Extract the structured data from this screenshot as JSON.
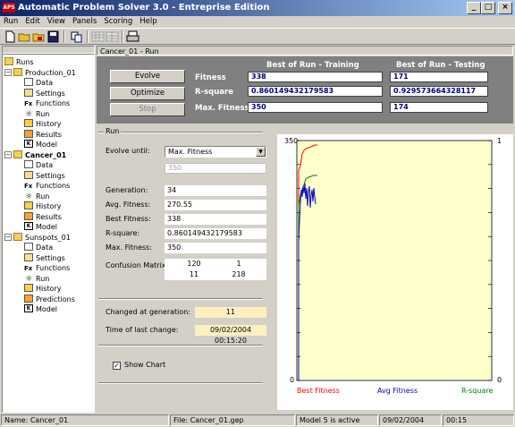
{
  "window": {
    "title": "Automatic Problem Solver 3.0 - Entreprise Edition",
    "logo_text": "APS"
  },
  "menu": [
    "Run",
    "Edit",
    "View",
    "Panels",
    "Scoring",
    "Help"
  ],
  "tree": {
    "root": "Runs",
    "projects": [
      {
        "name": "Production_01",
        "items": [
          "Data",
          "Settings",
          "Functions",
          "Run",
          "History",
          "Results",
          "Model"
        ]
      },
      {
        "name": "Cancer_01",
        "items": [
          "Data",
          "Settings",
          "Functions",
          "Run",
          "History",
          "Results",
          "Model"
        ]
      },
      {
        "name": "Sunspots_01",
        "items": [
          "Data",
          "Settings",
          "Functions",
          "Run",
          "History",
          "Predictions",
          "Model"
        ]
      }
    ]
  },
  "panel_header": "Cancer_01 - Run",
  "controls": {
    "evolve": "Evolve",
    "optimize": "Optimize",
    "stop": "Stop"
  },
  "results": {
    "col_training": "Best of Run - Training",
    "col_testing": "Best of Run - Testing",
    "rows": [
      {
        "label": "Fitness",
        "training": "338",
        "testing": "171"
      },
      {
        "label": "R-square",
        "training": "0.860149432179583",
        "testing": "0.929573664328117"
      },
      {
        "label": "Max. Fitness",
        "training": "350",
        "testing": "174"
      }
    ]
  },
  "run": {
    "group_title": "Run",
    "evolve_until_label": "Evolve until:",
    "evolve_until_value": "Max. Fitness",
    "evolve_until_target": "350",
    "generation_label": "Generation:",
    "generation": "34",
    "avg_fitness_label": "Avg. Fitness:",
    "avg_fitness": "270.55",
    "best_fitness_label": "Best Fitness:",
    "best_fitness": "338",
    "rsquare_label": "R-square:",
    "rsquare": "0.860149432179583",
    "max_fitness_label": "Max. Fitness:",
    "max_fitness": "350",
    "confusion_label": "Confusion Matrix:",
    "confusion": [
      [
        "120",
        "1"
      ],
      [
        "11",
        "218"
      ]
    ],
    "changed_label": "Changed at generation:",
    "changed": "11",
    "time_label": "Time of last change:",
    "time": "09/02/2004 00:15:20",
    "show_chart_label": "Show Chart",
    "show_chart_checked": true
  },
  "chart": {
    "y_left_max": "350",
    "y_left_min": "0",
    "y_right_max": "1",
    "y_right_min": "0",
    "legend": [
      {
        "label": "Best Fitness",
        "color": "#ff0000"
      },
      {
        "label": "Avg Fitness",
        "color": "#0000c0"
      },
      {
        "label": "R-square",
        "color": "#008000"
      }
    ],
    "bg_color": "#ffffcc"
  },
  "status": {
    "name": "Name: Cancer_01",
    "file": "File: Cancer_01.gep",
    "model": "Model 5 is active",
    "date": "09/02/2004",
    "time": "00:15"
  }
}
